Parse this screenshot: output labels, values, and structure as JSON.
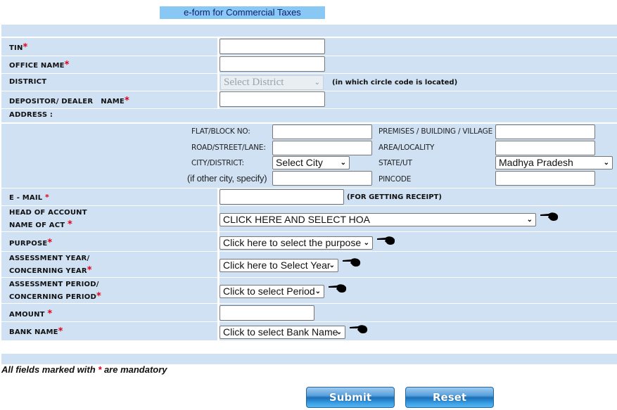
{
  "title": "e-form for Commercial Taxes",
  "required_marker": "*",
  "fields": {
    "tin": {
      "label": "TIN",
      "value": ""
    },
    "office_name": {
      "label": "OFFICE NAME",
      "value": ""
    },
    "district": {
      "label": "DISTRICT",
      "selected": "Select District",
      "hint": "(in which circle code is located)",
      "disabled": true
    },
    "depositor_name": {
      "label": "DEPOSITOR/ DEALER   NAME",
      "value": ""
    },
    "address": {
      "label": "ADDRESS :",
      "flat_block": {
        "label": "FLAT/BLOCK NO:",
        "value": ""
      },
      "premises": {
        "label": "PREMISES / BUILDING / VILLAGE",
        "value": ""
      },
      "road": {
        "label": "ROAD/STREET/LANE:",
        "value": ""
      },
      "area": {
        "label": "AREA/LOCALITY",
        "value": ""
      },
      "city": {
        "label": "CITY/DISTRICT:",
        "selected": "Select City"
      },
      "state": {
        "label": "STATE/UT",
        "selected": "Madhya Pradesh"
      },
      "other_city": {
        "label": "(if other city, specify)",
        "value": ""
      },
      "pincode": {
        "label": "PINCODE",
        "value": ""
      }
    },
    "email": {
      "label": "E - MAIL",
      "value": "",
      "hint": "(FOR GETTING RECEIPT)"
    },
    "hoa": {
      "label_line1": "HEAD OF ACCOUNT",
      "label_line2": "NAME OF ACT",
      "selected": "CLICK HERE AND SELECT HOA"
    },
    "purpose": {
      "label": "PURPOSE",
      "selected": "Click here to select the purpose"
    },
    "assessment_year": {
      "label_line1": "ASSESSMENT YEAR/",
      "label_line2": "CONCERNING YEAR",
      "selected": "Click here to Select Year"
    },
    "assessment_period": {
      "label_line1": "ASSESSMENT PERIOD/",
      "label_line2": "CONCERNING PERIOD",
      "selected": "Click to select Period"
    },
    "amount": {
      "label": "AMOUNT",
      "value": ""
    },
    "bank_name": {
      "label": "BANK NAME",
      "selected": "Click to select Bank Name"
    }
  },
  "note": {
    "prefix": "All fields marked with ",
    "marker": "*",
    "suffix": " are mandatory"
  },
  "buttons": {
    "submit": "Submit",
    "reset": "Reset"
  },
  "icons": {
    "pointer": "pointing-hand-icon",
    "dropdown": "chevron-down-icon"
  },
  "colors": {
    "row_bg": "#cfe1f3",
    "title_bg": "#89c7f5",
    "required": "#e0001b",
    "button": "#1b6fb8"
  }
}
